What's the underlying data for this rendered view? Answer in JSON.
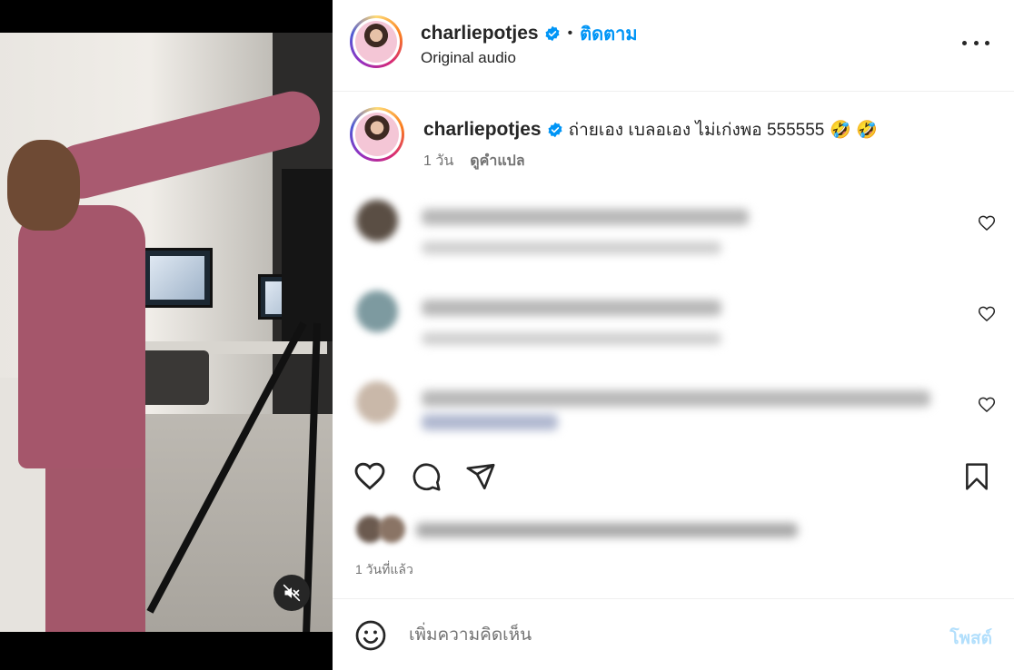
{
  "header": {
    "username": "charliepotjes",
    "separator": "•",
    "follow_label": "ติดตาม",
    "audio": "Original audio"
  },
  "caption": {
    "username": "charliepotjes",
    "text": "ถ่ายเอง เบลอเอง ไม่เก่งพอ 555555",
    "emojis": "🤣 🤣",
    "time": "1 วัน",
    "translate_label": "ดูคำแปล"
  },
  "post": {
    "date": "1 วันที่แล้ว"
  },
  "add_comment": {
    "placeholder": "เพิ่มความคิดเห็น",
    "post_label": "โพสต์"
  },
  "icons": {
    "verified": "verified-badge-icon",
    "more": "more-options-icon",
    "like": "heart-icon",
    "comment": "comment-icon",
    "share": "share-icon",
    "save": "bookmark-icon",
    "emoji": "emoji-icon",
    "mute": "muted-speaker-icon"
  },
  "colors": {
    "link_blue": "#0095f6",
    "post_disabled": "#b2dffc",
    "text_primary": "#262626",
    "text_secondary": "#737373"
  }
}
